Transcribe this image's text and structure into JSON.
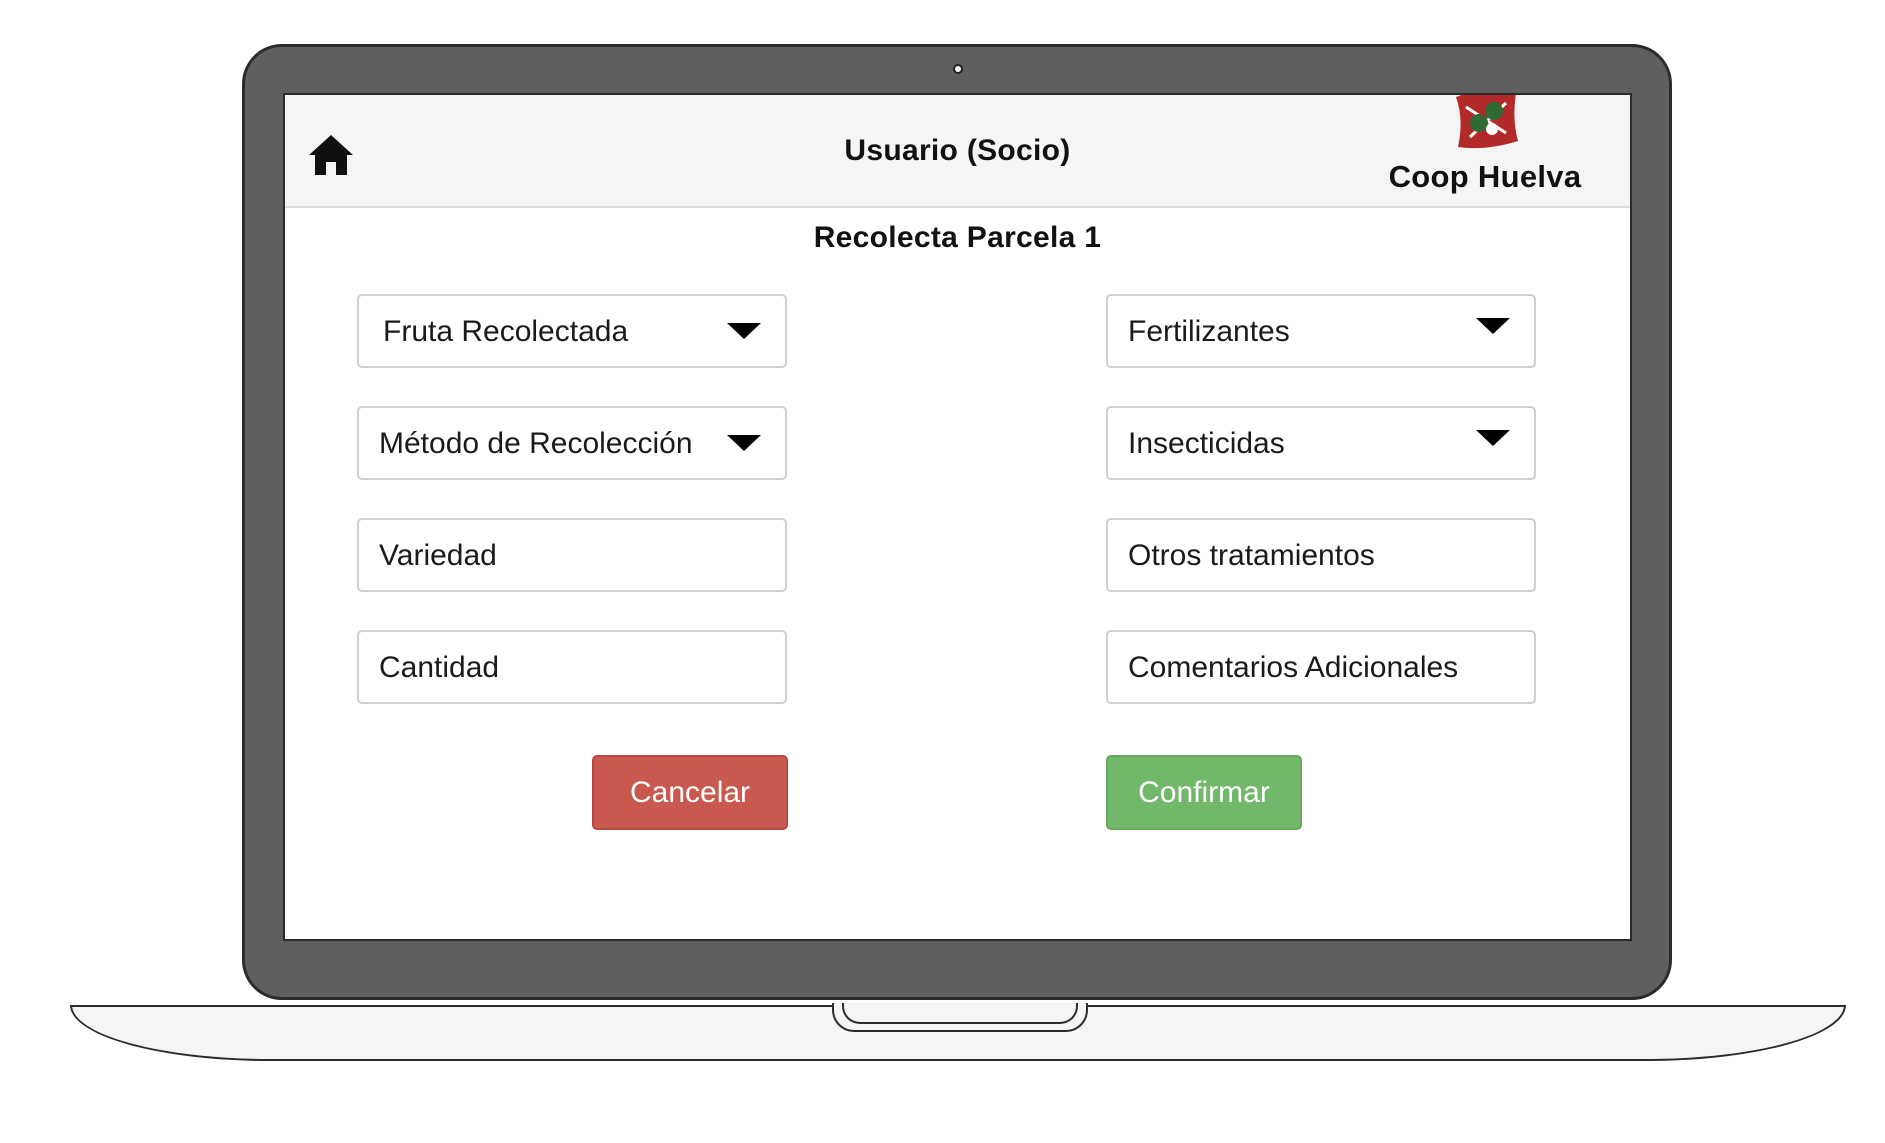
{
  "header": {
    "title": "Usuario (Socio)",
    "brand_name": "Coop Huelva"
  },
  "page": {
    "title": "Recolecta Parcela 1"
  },
  "form": {
    "left": [
      {
        "label": "Fruta Recolectada",
        "type": "dropdown"
      },
      {
        "label": "Método de Recolección",
        "type": "dropdown"
      },
      {
        "label": "Variedad",
        "type": "input"
      },
      {
        "label": "Cantidad",
        "type": "input"
      }
    ],
    "right": [
      {
        "label": "Fertilizantes",
        "type": "dropdown"
      },
      {
        "label": "Insecticidas",
        "type": "dropdown"
      },
      {
        "label": "Otros tratamientos",
        "type": "input"
      },
      {
        "label": "Comentarios Adicionales",
        "type": "input"
      }
    ]
  },
  "actions": {
    "cancel_label": "Cancelar",
    "confirm_label": "Confirmar"
  },
  "colors": {
    "cancel": "#c9584f",
    "confirm": "#72b86a",
    "logo_red": "#b22a2a",
    "logo_green": "#2f6b34",
    "frame": "#5f5f5f"
  },
  "icons": [
    "home-icon",
    "coop-huelva-logo",
    "chevron-down-icon"
  ]
}
